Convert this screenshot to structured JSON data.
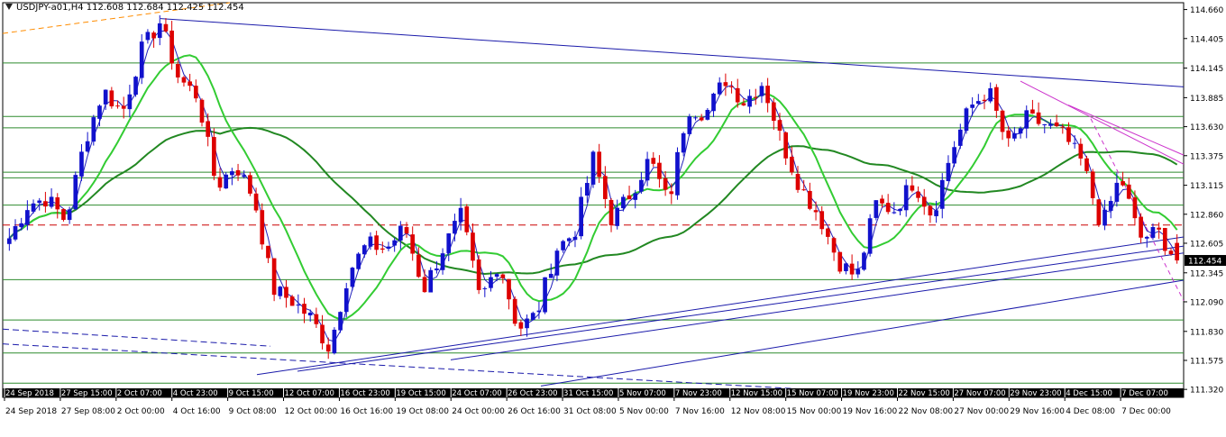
{
  "header": {
    "symbol_info": "USDJPY-a01,H4  112.608 112.684 112.425 112.454"
  },
  "colors": {
    "background": "#ffffff",
    "bull_candle": "#1111cc",
    "bear_candle": "#dd0000",
    "ma_fast": "#2222bb",
    "ma_mid": "#33cc33",
    "ma_slow": "#228822",
    "horizontal_levels": "#2e8b2e",
    "dashed_level": "#cc0000",
    "trendlines": "#1a1aaa",
    "channel": "#cc33cc",
    "fib_line": "#ff8c00",
    "price_marker_bg": "#000000"
  },
  "chart_data": {
    "type": "candlestick",
    "instrument": "USDJPY-a01",
    "timeframe": "H4",
    "ohlc_current": {
      "open": 112.608,
      "high": 112.684,
      "low": 112.425,
      "close": 112.454
    },
    "current_price_label": "112.454",
    "ylim": [
      111.25,
      114.72
    ],
    "y_ticks": [
      "114.660",
      "114.405",
      "114.145",
      "113.885",
      "113.630",
      "113.375",
      "113.115",
      "112.860",
      "112.605",
      "112.345",
      "112.090",
      "111.830",
      "111.575",
      "111.320"
    ],
    "x_ticks_bottom": [
      "24 Sep 2018",
      "27 Sep 08:00",
      "2 Oct 00:00",
      "4 Oct 16:00",
      "9 Oct 08:00",
      "12 Oct 00:00",
      "16 Oct 16:00",
      "19 Oct 08:00",
      "24 Oct 00:00",
      "26 Oct 16:00",
      "31 Oct 08:00",
      "5 Nov 00:00",
      "7 Nov 16:00",
      "12 Nov 08:00",
      "15 Nov 00:00",
      "19 Nov 16:00",
      "22 Nov 08:00",
      "27 Nov 00:00",
      "29 Nov 16:00",
      "4 Dec 08:00",
      "7 Dec 00:00"
    ],
    "x_ticks_top": [
      "24 Sep 2018",
      "27 Sep 15:00",
      "2 Oct 07:00",
      "4 Oct 23:00",
      "9 Oct 15:00",
      "12 Oct 07:00",
      "16 Oct 23:00",
      "19 Oct 15:00",
      "24 Oct 07:00",
      "26 Oct 23:00",
      "31 Oct 15:00",
      "5 Nov 07:00",
      "7 Nov 23:00",
      "12 Nov 15:00",
      "15 Nov 07:00",
      "19 Nov 23:00",
      "22 Nov 15:00",
      "27 Nov 07:00",
      "29 Nov 23:00",
      "4 Dec 15:00",
      "7 Dec 07:00"
    ],
    "key_points": [
      112.65,
      112.95,
      113.0,
      112.8,
      113.5,
      113.95,
      113.75,
      114.3,
      114.55,
      114.05,
      113.9,
      113.1,
      113.3,
      113.0,
      112.2,
      112.1,
      111.95,
      111.68,
      112.35,
      112.6,
      112.55,
      112.75,
      112.2,
      112.55,
      112.85,
      112.1,
      112.45,
      111.85,
      111.98,
      112.55,
      112.7,
      113.35,
      112.8,
      113.05,
      113.35,
      112.95,
      113.8,
      113.75,
      114.05,
      113.85,
      114.02,
      113.5,
      113.1,
      112.85,
      112.45,
      112.3,
      112.95,
      112.9,
      113.15,
      112.85,
      113.4,
      113.8,
      113.95,
      113.45,
      113.7,
      113.65,
      113.55,
      113.3,
      112.75,
      113.2,
      112.65,
      112.7,
      112.45
    ],
    "horizontal_levels": [
      114.19,
      113.72,
      113.62,
      113.23,
      113.18,
      112.94,
      112.285,
      111.93,
      111.64,
      111.375
    ],
    "dashed_level": 112.765,
    "ma_periods_note": ""
  }
}
